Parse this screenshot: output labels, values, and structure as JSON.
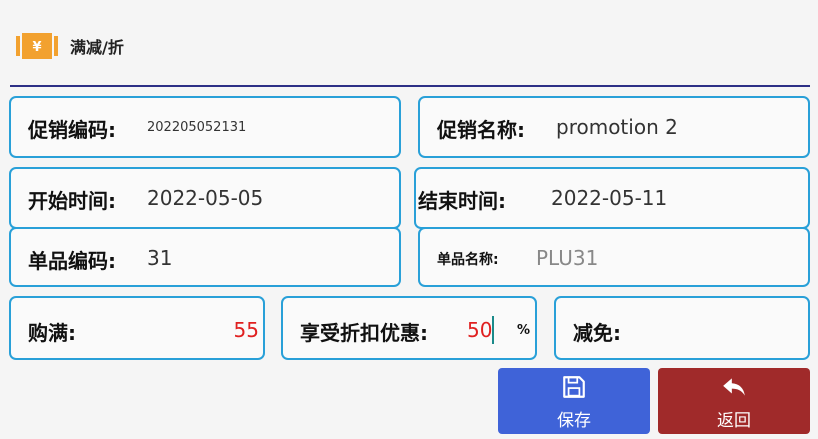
{
  "header": {
    "title": "满减/折"
  },
  "fields": {
    "promo_code": {
      "label": "促销编码:",
      "value": "202205052131"
    },
    "promo_name": {
      "label": "促销名称:",
      "value": "promotion 2"
    },
    "start_time": {
      "label": "开始时间:",
      "value": "2022-05-05"
    },
    "end_time": {
      "label": "结束时间:",
      "value": "2022-05-11"
    },
    "item_code": {
      "label": "单品编码:",
      "value": "31"
    },
    "item_name": {
      "label": "单品名称:",
      "value": "PLU31"
    },
    "spend_full": {
      "label": "购满:",
      "value": "55"
    },
    "discount": {
      "label": "享受折扣优惠:",
      "value": "50",
      "unit": "%"
    },
    "reduce": {
      "label": "减免:",
      "value": ""
    }
  },
  "buttons": {
    "save": "保存",
    "back": "返回"
  },
  "colors": {
    "accent_border": "#29a0d8",
    "save_bg": "#3f63d8",
    "back_bg": "#a02a2a",
    "value_red": "#e02020",
    "icon_orange": "#f2a12f"
  },
  "icons": {
    "logo": "coupon-icon",
    "save": "floppy-disk-icon",
    "back": "back-arrow-icon"
  }
}
